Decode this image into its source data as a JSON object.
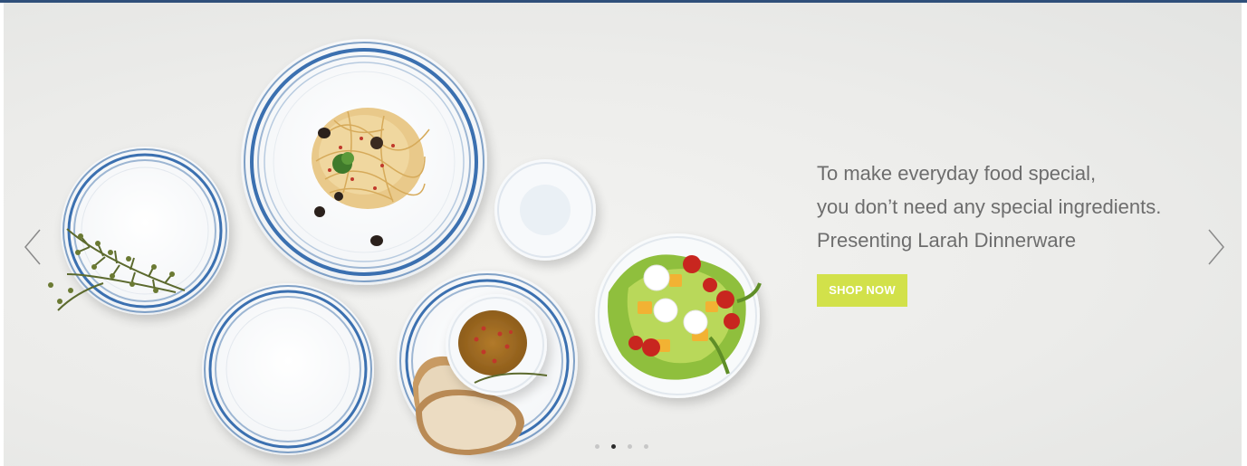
{
  "slide": {
    "caption_lines": [
      "To make everyday food special,",
      "you don’t need any special ingredients.",
      "Presenting Larah Dinnerware"
    ],
    "cta_label": "SHOP NOW"
  },
  "navigation": {
    "prev_icon": "chevron-left-icon",
    "next_icon": "chevron-right-icon"
  },
  "carousel": {
    "slide_count": 4,
    "active_index": 1
  },
  "colors": {
    "top_border": "#2f4f7a",
    "cta_background": "#d2e14a",
    "caption_text": "#6d6d6d",
    "plate_rim_blue": "#3a6fb0"
  }
}
